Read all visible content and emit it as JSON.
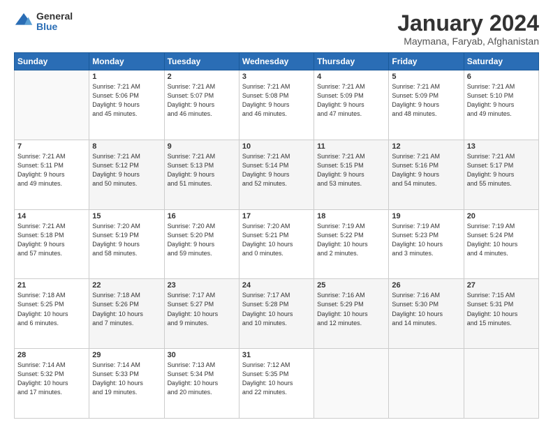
{
  "logo": {
    "general": "General",
    "blue": "Blue"
  },
  "header": {
    "title": "January 2024",
    "subtitle": "Maymana, Faryab, Afghanistan"
  },
  "weekdays": [
    "Sunday",
    "Monday",
    "Tuesday",
    "Wednesday",
    "Thursday",
    "Friday",
    "Saturday"
  ],
  "weeks": [
    [
      {
        "day": "",
        "info": ""
      },
      {
        "day": "1",
        "info": "Sunrise: 7:21 AM\nSunset: 5:06 PM\nDaylight: 9 hours\nand 45 minutes."
      },
      {
        "day": "2",
        "info": "Sunrise: 7:21 AM\nSunset: 5:07 PM\nDaylight: 9 hours\nand 46 minutes."
      },
      {
        "day": "3",
        "info": "Sunrise: 7:21 AM\nSunset: 5:08 PM\nDaylight: 9 hours\nand 46 minutes."
      },
      {
        "day": "4",
        "info": "Sunrise: 7:21 AM\nSunset: 5:09 PM\nDaylight: 9 hours\nand 47 minutes."
      },
      {
        "day": "5",
        "info": "Sunrise: 7:21 AM\nSunset: 5:09 PM\nDaylight: 9 hours\nand 48 minutes."
      },
      {
        "day": "6",
        "info": "Sunrise: 7:21 AM\nSunset: 5:10 PM\nDaylight: 9 hours\nand 49 minutes."
      }
    ],
    [
      {
        "day": "7",
        "info": "Sunrise: 7:21 AM\nSunset: 5:11 PM\nDaylight: 9 hours\nand 49 minutes."
      },
      {
        "day": "8",
        "info": "Sunrise: 7:21 AM\nSunset: 5:12 PM\nDaylight: 9 hours\nand 50 minutes."
      },
      {
        "day": "9",
        "info": "Sunrise: 7:21 AM\nSunset: 5:13 PM\nDaylight: 9 hours\nand 51 minutes."
      },
      {
        "day": "10",
        "info": "Sunrise: 7:21 AM\nSunset: 5:14 PM\nDaylight: 9 hours\nand 52 minutes."
      },
      {
        "day": "11",
        "info": "Sunrise: 7:21 AM\nSunset: 5:15 PM\nDaylight: 9 hours\nand 53 minutes."
      },
      {
        "day": "12",
        "info": "Sunrise: 7:21 AM\nSunset: 5:16 PM\nDaylight: 9 hours\nand 54 minutes."
      },
      {
        "day": "13",
        "info": "Sunrise: 7:21 AM\nSunset: 5:17 PM\nDaylight: 9 hours\nand 55 minutes."
      }
    ],
    [
      {
        "day": "14",
        "info": "Sunrise: 7:21 AM\nSunset: 5:18 PM\nDaylight: 9 hours\nand 57 minutes."
      },
      {
        "day": "15",
        "info": "Sunrise: 7:20 AM\nSunset: 5:19 PM\nDaylight: 9 hours\nand 58 minutes."
      },
      {
        "day": "16",
        "info": "Sunrise: 7:20 AM\nSunset: 5:20 PM\nDaylight: 9 hours\nand 59 minutes."
      },
      {
        "day": "17",
        "info": "Sunrise: 7:20 AM\nSunset: 5:21 PM\nDaylight: 10 hours\nand 0 minutes."
      },
      {
        "day": "18",
        "info": "Sunrise: 7:19 AM\nSunset: 5:22 PM\nDaylight: 10 hours\nand 2 minutes."
      },
      {
        "day": "19",
        "info": "Sunrise: 7:19 AM\nSunset: 5:23 PM\nDaylight: 10 hours\nand 3 minutes."
      },
      {
        "day": "20",
        "info": "Sunrise: 7:19 AM\nSunset: 5:24 PM\nDaylight: 10 hours\nand 4 minutes."
      }
    ],
    [
      {
        "day": "21",
        "info": "Sunrise: 7:18 AM\nSunset: 5:25 PM\nDaylight: 10 hours\nand 6 minutes."
      },
      {
        "day": "22",
        "info": "Sunrise: 7:18 AM\nSunset: 5:26 PM\nDaylight: 10 hours\nand 7 minutes."
      },
      {
        "day": "23",
        "info": "Sunrise: 7:17 AM\nSunset: 5:27 PM\nDaylight: 10 hours\nand 9 minutes."
      },
      {
        "day": "24",
        "info": "Sunrise: 7:17 AM\nSunset: 5:28 PM\nDaylight: 10 hours\nand 10 minutes."
      },
      {
        "day": "25",
        "info": "Sunrise: 7:16 AM\nSunset: 5:29 PM\nDaylight: 10 hours\nand 12 minutes."
      },
      {
        "day": "26",
        "info": "Sunrise: 7:16 AM\nSunset: 5:30 PM\nDaylight: 10 hours\nand 14 minutes."
      },
      {
        "day": "27",
        "info": "Sunrise: 7:15 AM\nSunset: 5:31 PM\nDaylight: 10 hours\nand 15 minutes."
      }
    ],
    [
      {
        "day": "28",
        "info": "Sunrise: 7:14 AM\nSunset: 5:32 PM\nDaylight: 10 hours\nand 17 minutes."
      },
      {
        "day": "29",
        "info": "Sunrise: 7:14 AM\nSunset: 5:33 PM\nDaylight: 10 hours\nand 19 minutes."
      },
      {
        "day": "30",
        "info": "Sunrise: 7:13 AM\nSunset: 5:34 PM\nDaylight: 10 hours\nand 20 minutes."
      },
      {
        "day": "31",
        "info": "Sunrise: 7:12 AM\nSunset: 5:35 PM\nDaylight: 10 hours\nand 22 minutes."
      },
      {
        "day": "",
        "info": ""
      },
      {
        "day": "",
        "info": ""
      },
      {
        "day": "",
        "info": ""
      }
    ]
  ]
}
